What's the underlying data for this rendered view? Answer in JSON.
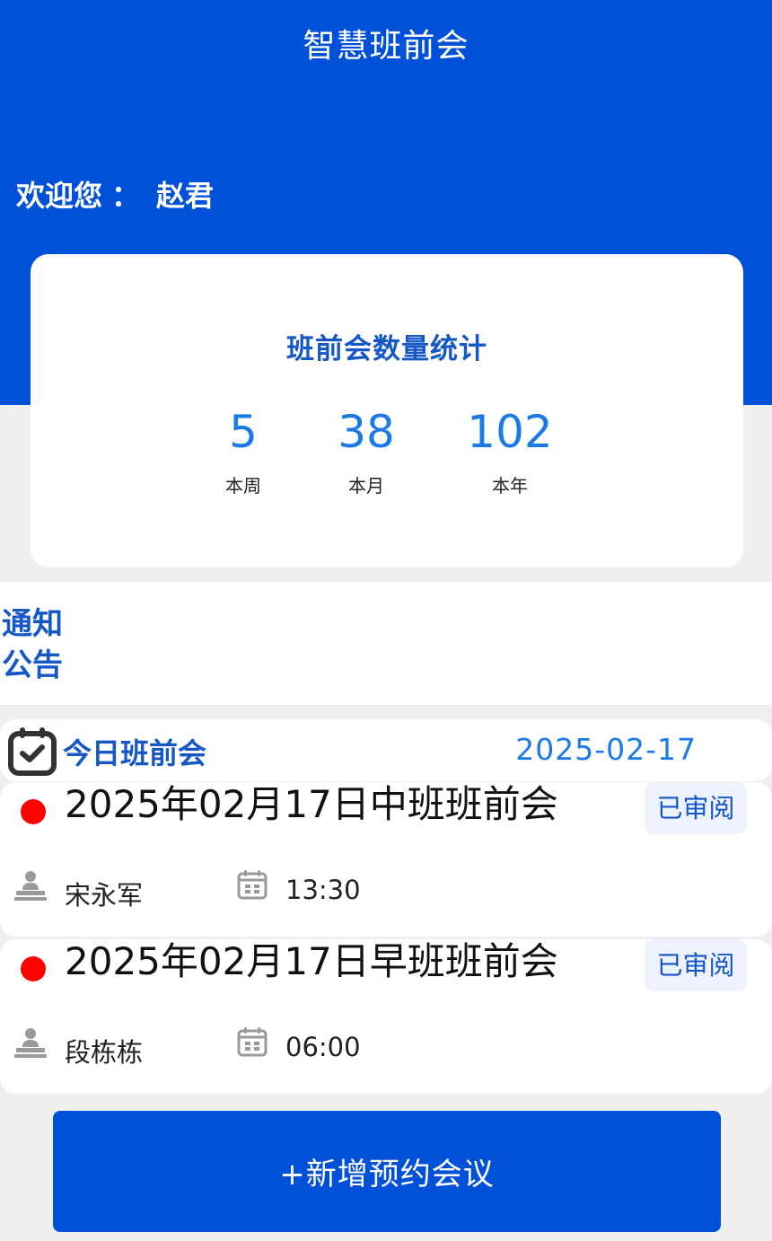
{
  "app": {
    "title": "智慧班前会"
  },
  "welcome": {
    "label": "欢迎您",
    "separator": "：",
    "user": "赵君"
  },
  "stats": {
    "title": "班前会数量统计",
    "items": [
      {
        "value": "5",
        "label": "本周"
      },
      {
        "value": "38",
        "label": "本月"
      },
      {
        "value": "102",
        "label": "本年"
      }
    ]
  },
  "notice": {
    "title": "通知公告"
  },
  "today": {
    "title": "今日班前会",
    "date": "2025-02-17"
  },
  "meetings": [
    {
      "title": "2025年02月17日中班班前会",
      "status": "已审阅",
      "person": "宋永军",
      "time": "13:30"
    },
    {
      "title": "2025年02月17日早班班前会",
      "status": "已审阅",
      "person": "段栋栋",
      "time": "06:00"
    }
  ],
  "actions": {
    "add_label": "+新增预约会议"
  },
  "colors": {
    "primary": "#0050d8",
    "accent": "#1c7ae6",
    "title_blue": "#1557c4",
    "status_dot": "#ff0000"
  }
}
